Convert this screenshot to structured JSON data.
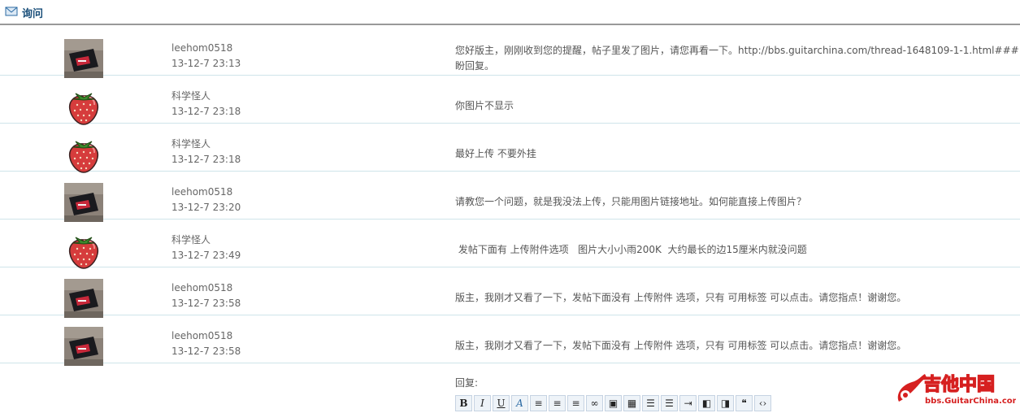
{
  "header": {
    "title": "询问"
  },
  "messages": [
    {
      "avatar": "photo",
      "user": "leehom0518",
      "time": "13-12-7 23:13",
      "text": "您好版主，刚刚收到您的提醒，帖子里发了图片，请您再看一下。http://bbs.guitarchina.com/thread-1648109-1-1.html###",
      "text2": "盼回复。"
    },
    {
      "avatar": "strawberry",
      "user": "科学怪人",
      "time": "13-12-7 23:18",
      "text": "你图片不显示"
    },
    {
      "avatar": "strawberry",
      "user": "科学怪人",
      "time": "13-12-7 23:18",
      "text": "最好上传 不要外挂"
    },
    {
      "avatar": "photo",
      "user": "leehom0518",
      "time": "13-12-7 23:20",
      "text": "请教您一个问题，就是我没法上传，只能用图片链接地址。如何能直接上传图片？"
    },
    {
      "avatar": "strawberry",
      "user": "科学怪人",
      "time": "13-12-7 23:49",
      "text": " 发帖下面有 上传附件选项   图片大小小雨200K  大约最长的边15厘米内就没问题"
    },
    {
      "avatar": "photo",
      "user": "leehom0518",
      "time": "13-12-7 23:58",
      "text": "版主，我刚才又看了一下，发帖下面没有 上传附件 选项，只有 可用标签 可以点击。请您指点！谢谢您。"
    },
    {
      "avatar": "photo",
      "user": "leehom0518",
      "time": "13-12-7 23:58",
      "text": "版主，我刚才又看了一下，发帖下面没有 上传附件 选项，只有 可用标签 可以点击。请您指点！谢谢您。"
    }
  ],
  "reply": {
    "label": "回复:",
    "toolbar": [
      {
        "icon": "bold-icon",
        "glyph": "B"
      },
      {
        "icon": "italic-icon",
        "glyph": "I"
      },
      {
        "icon": "underline-icon",
        "glyph": "U"
      },
      {
        "icon": "font-color-icon",
        "glyph": "A"
      },
      {
        "icon": "align-left-icon",
        "glyph": "≡"
      },
      {
        "icon": "align-center-icon",
        "glyph": "≡"
      },
      {
        "icon": "align-right-icon",
        "glyph": "≡"
      },
      {
        "icon": "link-icon",
        "glyph": "∞"
      },
      {
        "icon": "image-icon",
        "glyph": "▣"
      },
      {
        "icon": "attach-image-icon",
        "glyph": "▦"
      },
      {
        "icon": "ordered-list-icon",
        "glyph": "☰"
      },
      {
        "icon": "unordered-list-icon",
        "glyph": "☰"
      },
      {
        "icon": "indent-icon",
        "glyph": "⇥"
      },
      {
        "icon": "float-left-icon",
        "glyph": "◧"
      },
      {
        "icon": "float-right-icon",
        "glyph": "◨"
      },
      {
        "icon": "quote-icon",
        "glyph": "❝"
      },
      {
        "icon": "code-icon",
        "glyph": "‹›"
      }
    ]
  },
  "logo": {
    "brand": "吉他中国",
    "url_text": "bbs.GuitarChina.com"
  },
  "colors": {
    "title": "#1a4f7a",
    "row_border": "#cfe4ea",
    "logo_red": "#d62020"
  }
}
